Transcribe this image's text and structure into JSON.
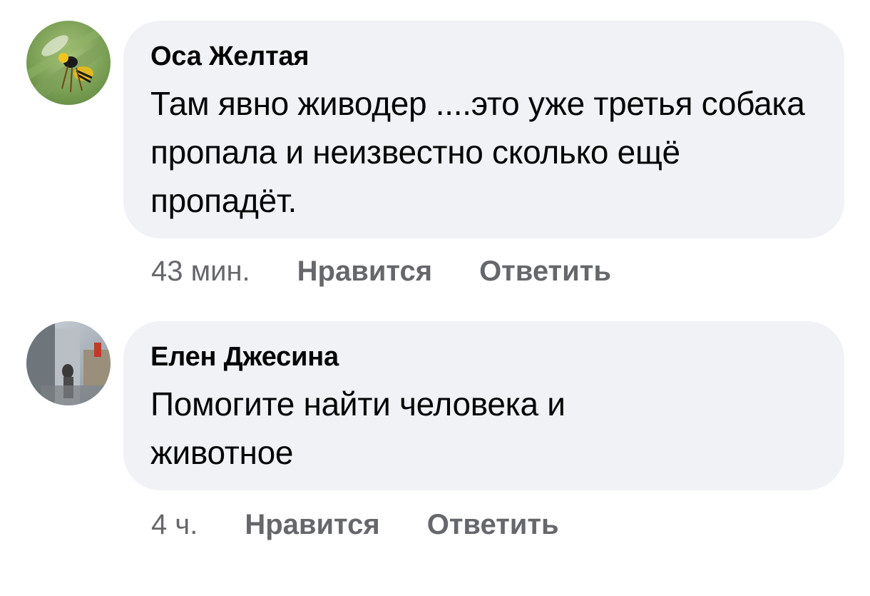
{
  "comments": [
    {
      "author": "Оса Желтая",
      "text": "Там явно живодер ....это уже третья собака пропала и неизвестно сколько ещё пропадёт.",
      "time": "43 мин.",
      "like_label": "Нравится",
      "reply_label": "Ответить",
      "avatar_icon": "wasp-photo-avatar"
    },
    {
      "author": "Елен Джесина",
      "text": "Помогите найти человека и животное",
      "time": "4 ч.",
      "like_label": "Нравится",
      "reply_label": "Ответить",
      "avatar_icon": "person-photo-avatar"
    }
  ],
  "colors": {
    "bubble_bg": "#f0f2f5",
    "text": "#050505",
    "meta": "#65676b"
  }
}
